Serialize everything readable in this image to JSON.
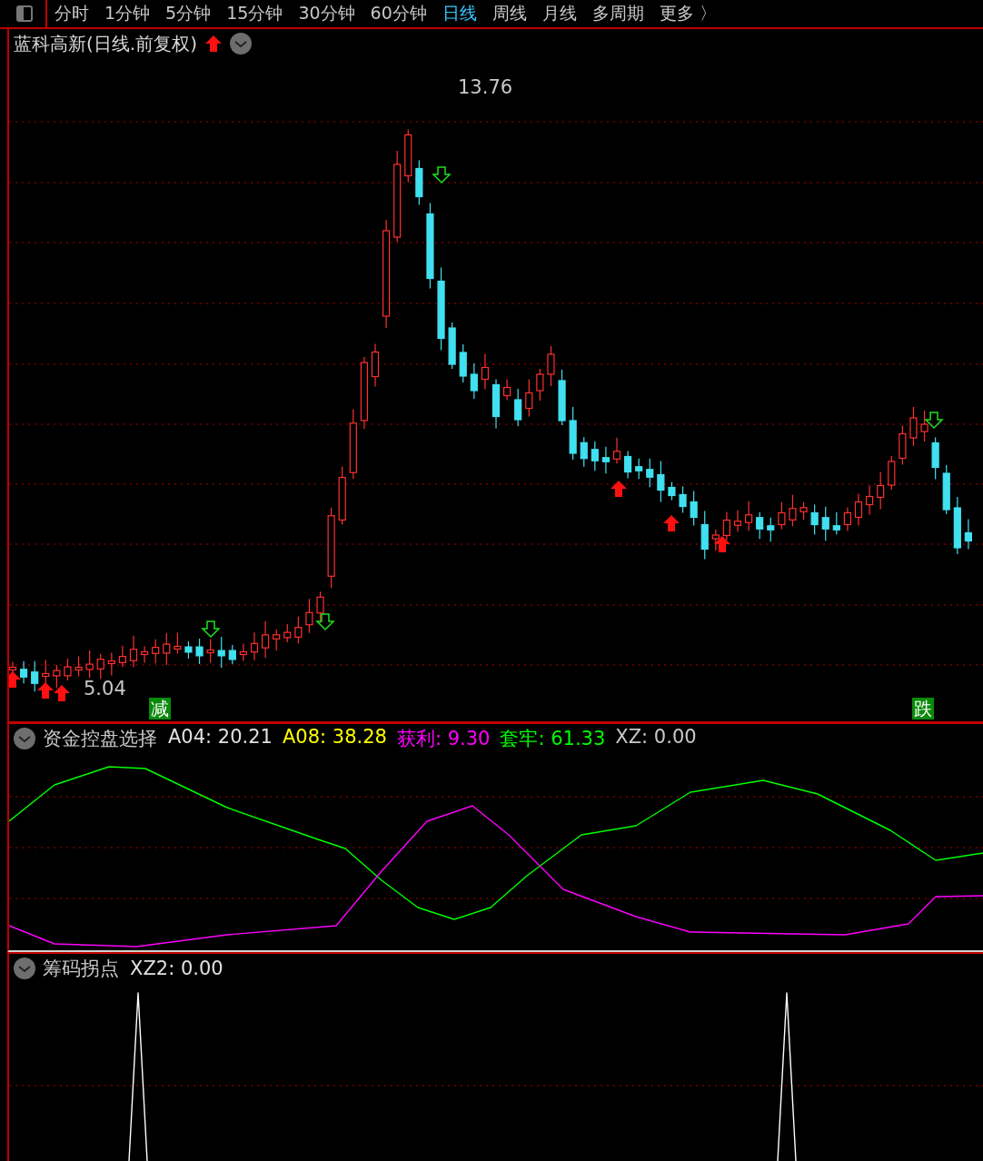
{
  "toolbar": {
    "periods": [
      {
        "label": "分时",
        "selected": false
      },
      {
        "label": "1分钟",
        "selected": false
      },
      {
        "label": "5分钟",
        "selected": false
      },
      {
        "label": "15分钟",
        "selected": false
      },
      {
        "label": "30分钟",
        "selected": false
      },
      {
        "label": "60分钟",
        "selected": false
      },
      {
        "label": "日线",
        "selected": true
      },
      {
        "label": "周线",
        "selected": false
      },
      {
        "label": "月线",
        "selected": false
      },
      {
        "label": "多周期",
        "selected": false
      },
      {
        "label": "更多 〉",
        "selected": false
      }
    ]
  },
  "main_chart": {
    "title": "蓝科高新(日线.前复权)",
    "high_label": "13.76",
    "low_label": "5.04",
    "markers": [
      {
        "text": "减"
      },
      {
        "text": "跌"
      }
    ]
  },
  "indicator": {
    "name": "资金控盘选择",
    "values": [
      {
        "label": "A04: 20.21",
        "color": "#e0e0e0"
      },
      {
        "label": "A08: 38.28",
        "color": "#ffff00"
      },
      {
        "label": "获利: 9.30",
        "color": "#ff00ff"
      },
      {
        "label": "套牢: 61.33",
        "color": "#00ff00"
      },
      {
        "label": "XZ: 0.00",
        "color": "#c8c8c8"
      }
    ]
  },
  "sub_indicator": {
    "name": "筹码拐点",
    "values": [
      {
        "label": "XZ2: 0.00",
        "color": "#e0e0e0"
      }
    ]
  }
}
